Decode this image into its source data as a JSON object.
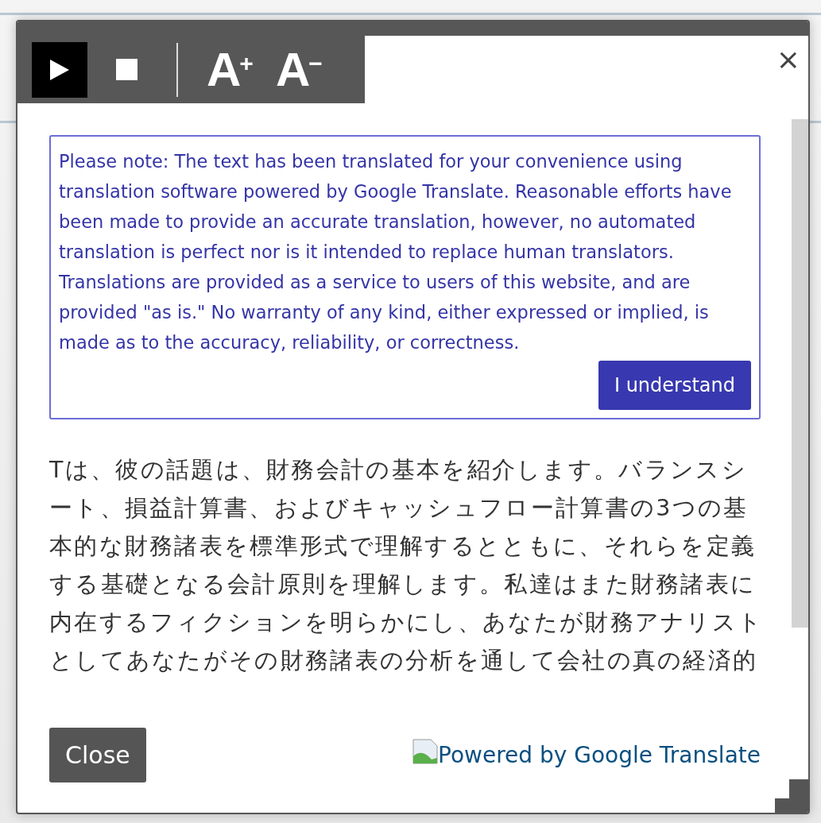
{
  "toolbar": {
    "media_buttons": [
      {
        "kind": "play",
        "selected": true
      },
      {
        "kind": "stop",
        "selected": false
      }
    ],
    "font_buttons": [
      {
        "label": "A$^{+}$"
      },
      {
        "label": "A$^{−}$"
      }
    ]
  },
  "close_icon": "×",
  "notice": {
    "text": "Please note: The text has been translated for your convenience using translation software powered by Google Translate. Reasonable efforts have been made to provide an accurate translation, however, no automated translation is perfect nor is it intended to replace human translators. Translations are provided as a service to users of this website, and are provided \"as is.\" No warranty of any kind, either expressed or implied, is made as to the accuracy, reliability, or correctness.",
    "button": "I understand"
  },
  "body_text": "Tは、彼の話題は、財務会計の基本を紹介します。バランスシート、損益計算書、およびキャッシュフロー計算書の3つの基本的な財務諸表を標準形式で理解するとともに、それらを定義する基礎となる会計原則を理解します。私達はまた財務諸表に内在するフィクションを明らかにし、あなたが財務アナリストとしてあなたがその財務諸表の分析を通して会社の真の経済的",
  "footer": {
    "close_button": "Close",
    "powered_link": "Powered by Google Translate"
  }
}
